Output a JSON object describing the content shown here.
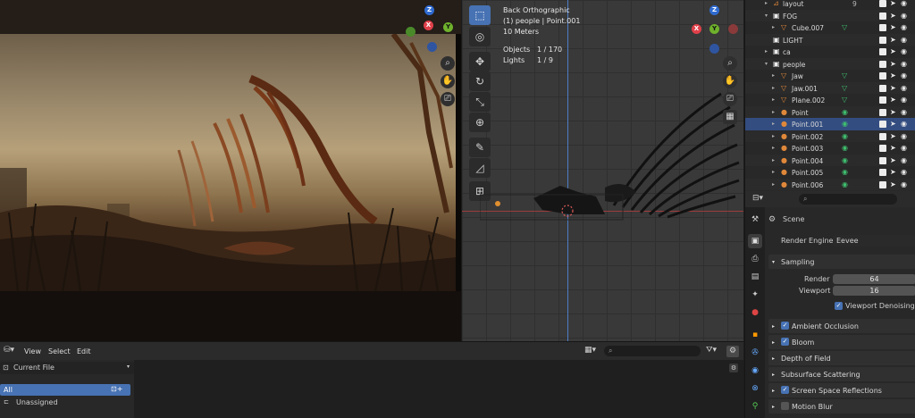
{
  "viewport3d": {
    "view_name": "Back Orthographic",
    "active_label": "(1) people | Point.001",
    "scale": "10 Meters",
    "objects_label": "Objects",
    "objects_value": "1 / 170",
    "lights_label": "Lights",
    "lights_value": "1 / 9",
    "axes": {
      "x": "X",
      "y": "Y",
      "z": "Z"
    }
  },
  "render_view": {
    "axes": {
      "x": "X",
      "y": "Y",
      "z": "Z"
    }
  },
  "outliner": {
    "rows": [
      {
        "name": "layout",
        "extra": "9"
      },
      {
        "name": "FOG"
      },
      {
        "name": "Cube.007"
      },
      {
        "name": "LIGHT"
      },
      {
        "name": "ca"
      },
      {
        "name": "people"
      },
      {
        "name": "Jaw"
      },
      {
        "name": "Jaw.001"
      },
      {
        "name": "Plane.002"
      },
      {
        "name": "Point"
      },
      {
        "name": "Point.001"
      },
      {
        "name": "Point.002"
      },
      {
        "name": "Point.003"
      },
      {
        "name": "Point.004"
      },
      {
        "name": "Point.005"
      },
      {
        "name": "Point.006"
      }
    ],
    "colors": {
      "selected_row": "#334d80",
      "object_orange": "#e0883a",
      "data_green": "#3fbf6f"
    }
  },
  "properties": {
    "search_placeholder": "",
    "scene_label": "Scene",
    "render_engine_label": "Render Engine",
    "render_engine_value": "Eevee",
    "sampling_label": "Sampling",
    "render_label": "Render",
    "render_value": "64",
    "viewport_label": "Viewport",
    "viewport_value": "16",
    "viewport_denoising": "Viewport Denoising",
    "panels": [
      {
        "label": "Ambient Occlusion",
        "checkbox": true
      },
      {
        "label": "Bloom",
        "checkbox": true
      },
      {
        "label": "Depth of Field",
        "checkbox": false
      },
      {
        "label": "Subsurface Scattering",
        "checkbox": false
      },
      {
        "label": "Screen Space Reflections",
        "checkbox": true
      },
      {
        "label": "Motion Blur",
        "checkbox": "off"
      }
    ]
  },
  "filebrowser": {
    "menu": [
      "View",
      "Select",
      "Edit"
    ],
    "current_file": "Current File",
    "items": [
      "All",
      "Unassigned"
    ],
    "accent": "#4772b3"
  }
}
